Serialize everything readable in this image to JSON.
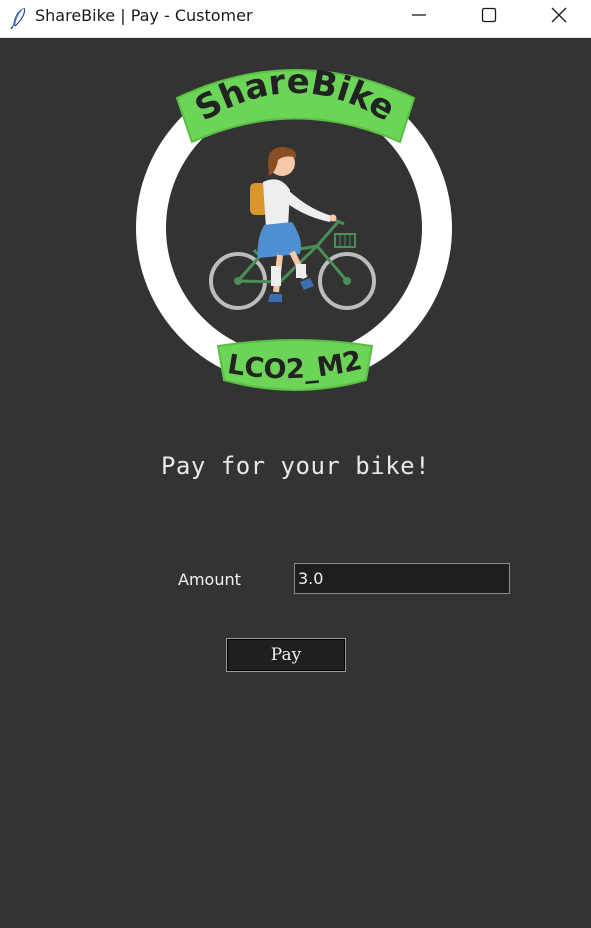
{
  "window": {
    "title": "ShareBike | Pay - Customer",
    "icon": "feather-icon",
    "controls": [
      "minimize-icon",
      "maximize-icon",
      "close-icon"
    ]
  },
  "logo": {
    "brand_text": "ShareBike",
    "station_text": "LCO2_M2",
    "ring_color": "#ffffff",
    "banner_color": "#6cd456"
  },
  "main": {
    "heading": "Pay for your bike!",
    "amount_label": "Amount",
    "amount_value": "3.0",
    "pay_button_label": "Pay"
  },
  "colors": {
    "background": "#333333",
    "input_background": "#1e1e1e",
    "text": "#f0f0f0"
  }
}
